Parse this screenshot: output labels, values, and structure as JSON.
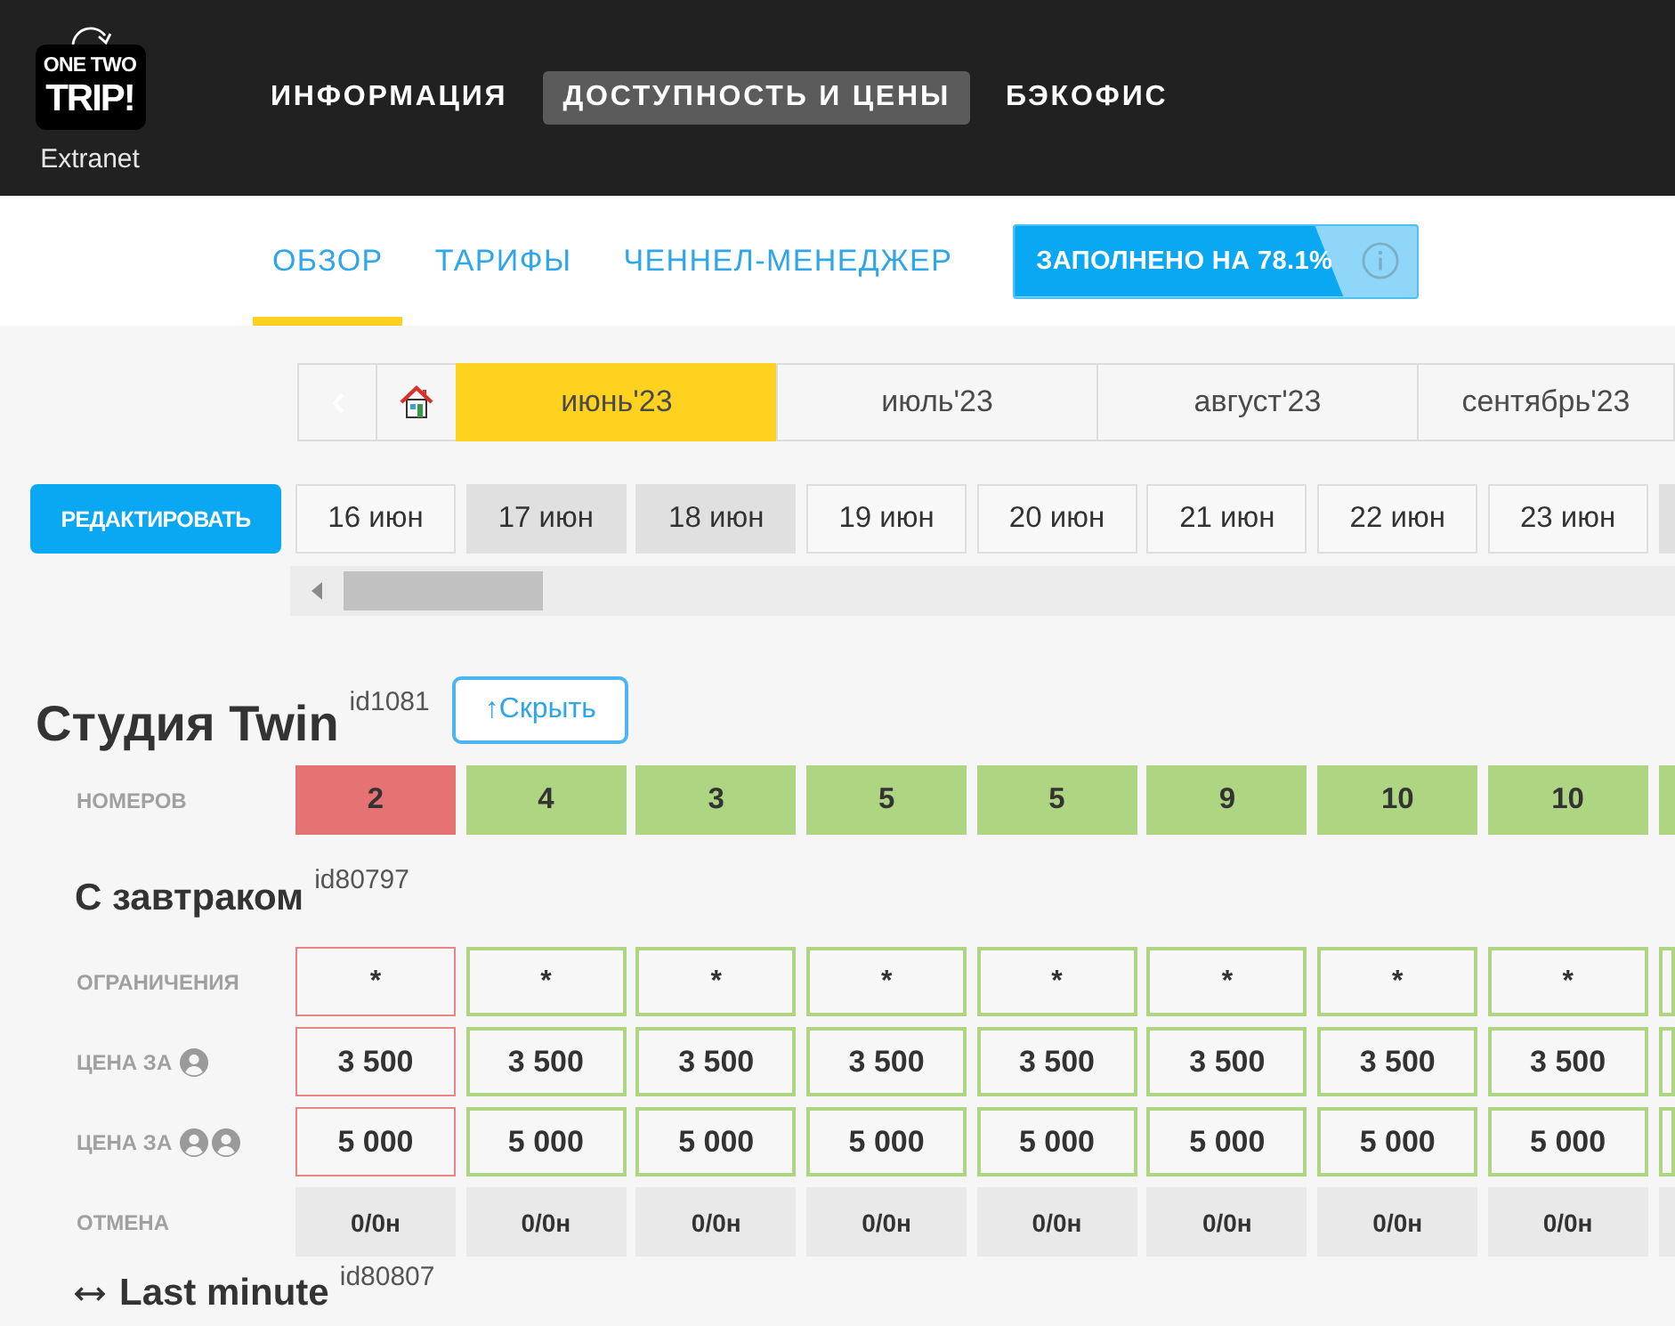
{
  "header": {
    "logo": {
      "lines": [
        "ONE TWO",
        "TRIP!"
      ],
      "caption": "Extranet"
    },
    "nav": [
      {
        "label": "ИНФОРМАЦИЯ",
        "selected": false
      },
      {
        "label": "ДОСТУПНОСТЬ И ЦЕНЫ",
        "selected": true
      },
      {
        "label": "БЭКОФИС",
        "selected": false
      }
    ]
  },
  "subnav": {
    "tabs": [
      {
        "label": "ОБЗОР",
        "selected": true
      },
      {
        "label": "ТАРИФЫ",
        "selected": false
      },
      {
        "label": "ЧЕННЕЛ-МЕНЕДЖЕР",
        "selected": false
      }
    ],
    "occupancy": {
      "label": "ЗАПОЛНЕНО НА 78.1%",
      "level": 0.781
    }
  },
  "calendar": {
    "months": [
      {
        "label": "июнь'23",
        "selected": true
      },
      {
        "label": "июль'23",
        "selected": false
      },
      {
        "label": "август'23",
        "selected": false
      },
      {
        "label": "сентябрь'23",
        "selected": false
      }
    ],
    "edit_button": "РЕДАКТИРОВАТЬ",
    "dates": [
      {
        "label": "16 июн",
        "weekend": false
      },
      {
        "label": "17 июн",
        "weekend": true
      },
      {
        "label": "18 июн",
        "weekend": true
      },
      {
        "label": "19 июн",
        "weekend": false
      },
      {
        "label": "20 июн",
        "weekend": false
      },
      {
        "label": "21 июн",
        "weekend": false
      },
      {
        "label": "22 июн",
        "weekend": false
      },
      {
        "label": "23 июн",
        "weekend": false
      },
      {
        "weekend": true
      }
    ]
  },
  "room": {
    "title": "Студия Twin",
    "id": "id1081",
    "toggle_button": "↑Скрыть",
    "availability_label": "НОМЕРОВ",
    "availability": [
      {
        "value": "2",
        "low": true
      },
      {
        "value": "4",
        "low": false
      },
      {
        "value": "3",
        "low": false
      },
      {
        "value": "5",
        "low": false
      },
      {
        "value": "5",
        "low": false
      },
      {
        "value": "9",
        "low": false
      },
      {
        "value": "10",
        "low": false
      },
      {
        "value": "10",
        "low": false
      },
      {
        "low": false
      }
    ]
  },
  "rates": [
    {
      "title": "С завтраком",
      "id": "id80797",
      "derived": false,
      "rows": [
        {
          "kind": "restrictions",
          "label": "ОГРАНИЧЕНИЯ",
          "values": [
            "*",
            "*",
            "*",
            "*",
            "*",
            "*",
            "*",
            "*"
          ]
        },
        {
          "kind": "single_price",
          "label": "ЦЕНА ЗА",
          "values": [
            "3 500",
            "3 500",
            "3 500",
            "3 500",
            "3 500",
            "3 500",
            "3 500",
            "3 500"
          ]
        },
        {
          "kind": "double_price",
          "label": "ЦЕНА ЗА",
          "values": [
            "5 000",
            "5 000",
            "5 000",
            "5 000",
            "5 000",
            "5 000",
            "5 000",
            "5 000"
          ]
        },
        {
          "kind": "cancellation",
          "label": "ОТМЕНА",
          "values": [
            "0/0н",
            "0/0н",
            "0/0н",
            "0/0н",
            "0/0н",
            "0/0н",
            "0/0н",
            "0/0н"
          ]
        }
      ]
    },
    {
      "title": "Last minute",
      "id": "id80807",
      "derived": true
    }
  ]
}
